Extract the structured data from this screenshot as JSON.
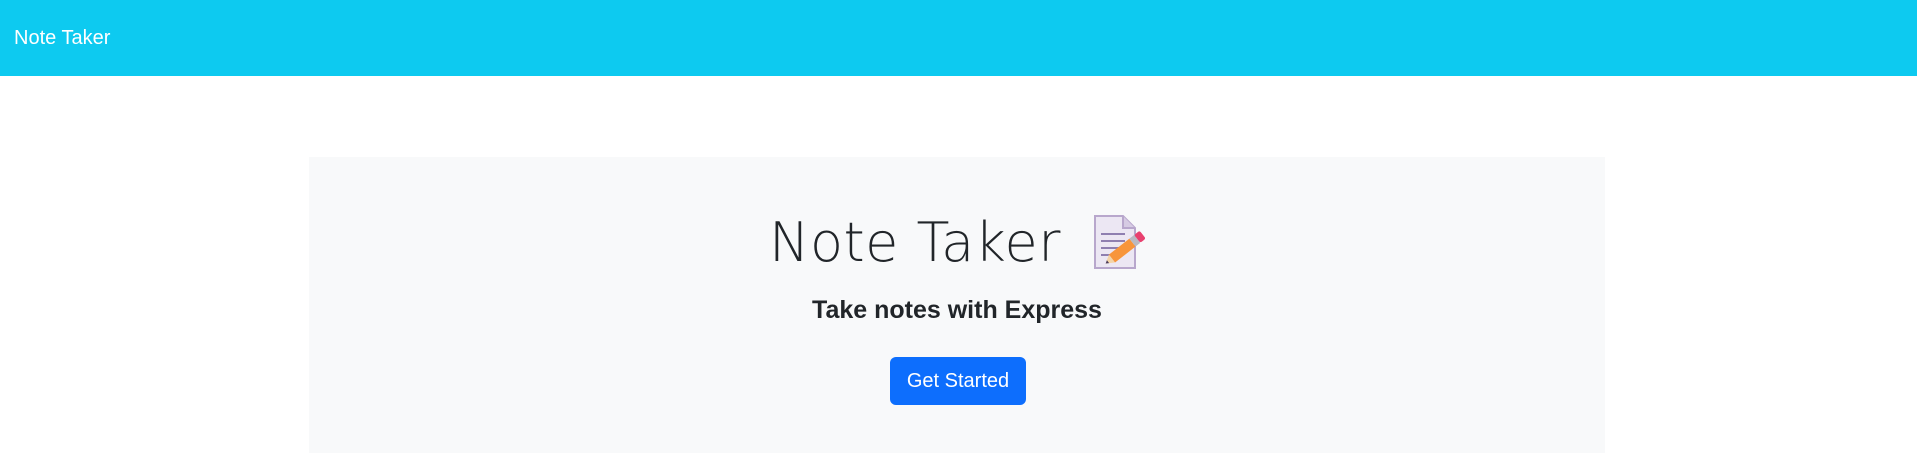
{
  "navbar": {
    "brand": "Note Taker",
    "background_color": "#0dcaf0"
  },
  "hero": {
    "title": "Note Taker",
    "title_icon": "memo-icon",
    "subtitle": "Take notes with Express",
    "button_label": "Get Started",
    "button_color": "#0d6efd",
    "panel_color": "#f8f9fa"
  }
}
